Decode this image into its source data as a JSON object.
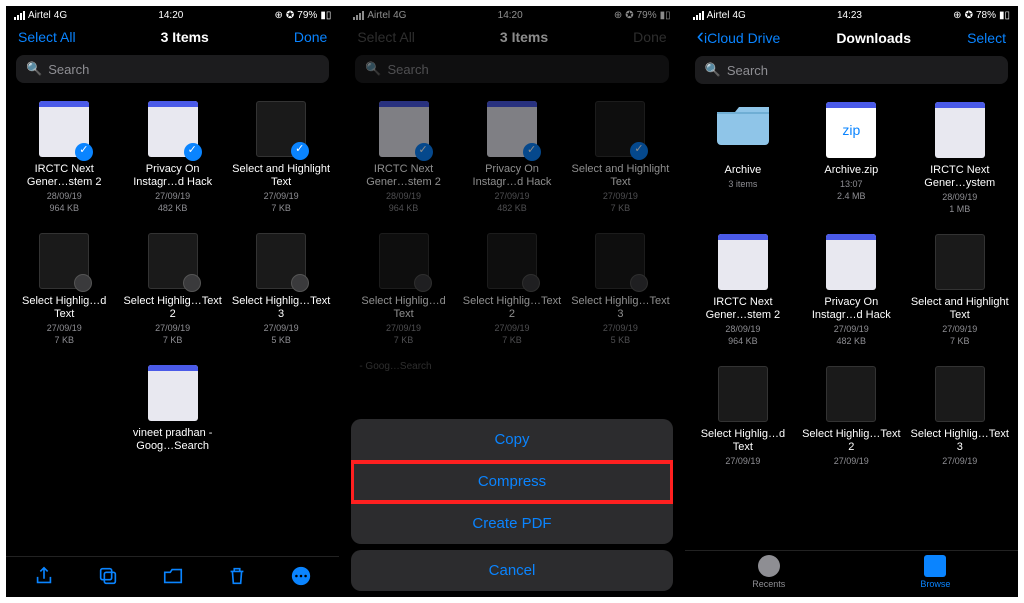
{
  "status": {
    "carrier": "Airtel",
    "net": "4G",
    "time1": "14:20",
    "time2": "14:20",
    "time3": "14:23",
    "battery1": "79%",
    "battery2": "79%",
    "battery3": "78%"
  },
  "screen1": {
    "select_all": "Select All",
    "title": "3 Items",
    "done": "Done",
    "search_ph": "Search",
    "items": [
      {
        "name": "IRCTC Next Gener…stem 2",
        "date": "28/09/19",
        "size": "964 KB",
        "thumb": "doc",
        "sel": true
      },
      {
        "name": "Privacy On Instagr…d Hack",
        "date": "27/09/19",
        "size": "482 KB",
        "thumb": "doc",
        "sel": true
      },
      {
        "name": "Select and Highlight Text",
        "date": "27/09/19",
        "size": "7 KB",
        "thumb": "dark",
        "sel": true
      },
      {
        "name": "Select Highlig…d Text",
        "date": "27/09/19",
        "size": "7 KB",
        "thumb": "dark",
        "sel": false
      },
      {
        "name": "Select Highlig…Text 2",
        "date": "27/09/19",
        "size": "7 KB",
        "thumb": "dark",
        "sel": false
      },
      {
        "name": "Select Highlig…Text 3",
        "date": "27/09/19",
        "size": "5 KB",
        "thumb": "dark",
        "sel": false
      },
      {
        "name": "vineet pradhan - Goog…Search",
        "date": "",
        "size": "",
        "thumb": "doc",
        "sel": null
      }
    ]
  },
  "screen2": {
    "select_all": "Select All",
    "title": "3 Items",
    "done": "Done",
    "search_ph": "Search",
    "items": [
      {
        "name": "IRCTC Next Gener…stem 2",
        "date": "28/09/19",
        "size": "964 KB",
        "thumb": "doc",
        "sel": true
      },
      {
        "name": "Privacy On Instagr…d Hack",
        "date": "27/09/19",
        "size": "482 KB",
        "thumb": "doc",
        "sel": true
      },
      {
        "name": "Select and Highlight Text",
        "date": "27/09/19",
        "size": "7 KB",
        "thumb": "dark",
        "sel": true
      },
      {
        "name": "Select Highlig…d Text",
        "date": "27/09/19",
        "size": "7 KB",
        "thumb": "dark",
        "sel": false
      },
      {
        "name": "Select Highlig…Text 2",
        "date": "27/09/19",
        "size": "7 KB",
        "thumb": "dark",
        "sel": false
      },
      {
        "name": "Select Highlig…Text 3",
        "date": "27/09/19",
        "size": "5 KB",
        "thumb": "dark",
        "sel": false
      }
    ],
    "sheet": {
      "copy": "Copy",
      "compress": "Compress",
      "create_pdf": "Create PDF",
      "cancel": "Cancel",
      "trailing": "- Goog…Search"
    }
  },
  "screen3": {
    "back": "iCloud Drive",
    "title": "Downloads",
    "select": "Select",
    "search_ph": "Search",
    "items": [
      {
        "name": "Archive",
        "date": "3 items",
        "size": "",
        "thumb": "folder"
      },
      {
        "name": "Archive.zip",
        "date": "13:07",
        "size": "2.4 MB",
        "thumb": "zip"
      },
      {
        "name": "IRCTC Next Gener…ystem",
        "date": "28/09/19",
        "size": "1 MB",
        "thumb": "doc"
      },
      {
        "name": "IRCTC Next Gener…stem 2",
        "date": "28/09/19",
        "size": "964 KB",
        "thumb": "doc"
      },
      {
        "name": "Privacy On Instagr…d Hack",
        "date": "27/09/19",
        "size": "482 KB",
        "thumb": "doc"
      },
      {
        "name": "Select and Highlight Text",
        "date": "27/09/19",
        "size": "7 KB",
        "thumb": "dark"
      },
      {
        "name": "Select Highlig…d Text",
        "date": "27/09/19",
        "size": "",
        "thumb": "dark"
      },
      {
        "name": "Select Highlig…Text 2",
        "date": "27/09/19",
        "size": "",
        "thumb": "dark"
      },
      {
        "name": "Select Highlig…Text 3",
        "date": "27/09/19",
        "size": "",
        "thumb": "dark"
      }
    ],
    "tabs": {
      "recents": "Recents",
      "browse": "Browse"
    }
  },
  "status_icons": {
    "alarm": "⏰",
    "lock": "🔒"
  }
}
